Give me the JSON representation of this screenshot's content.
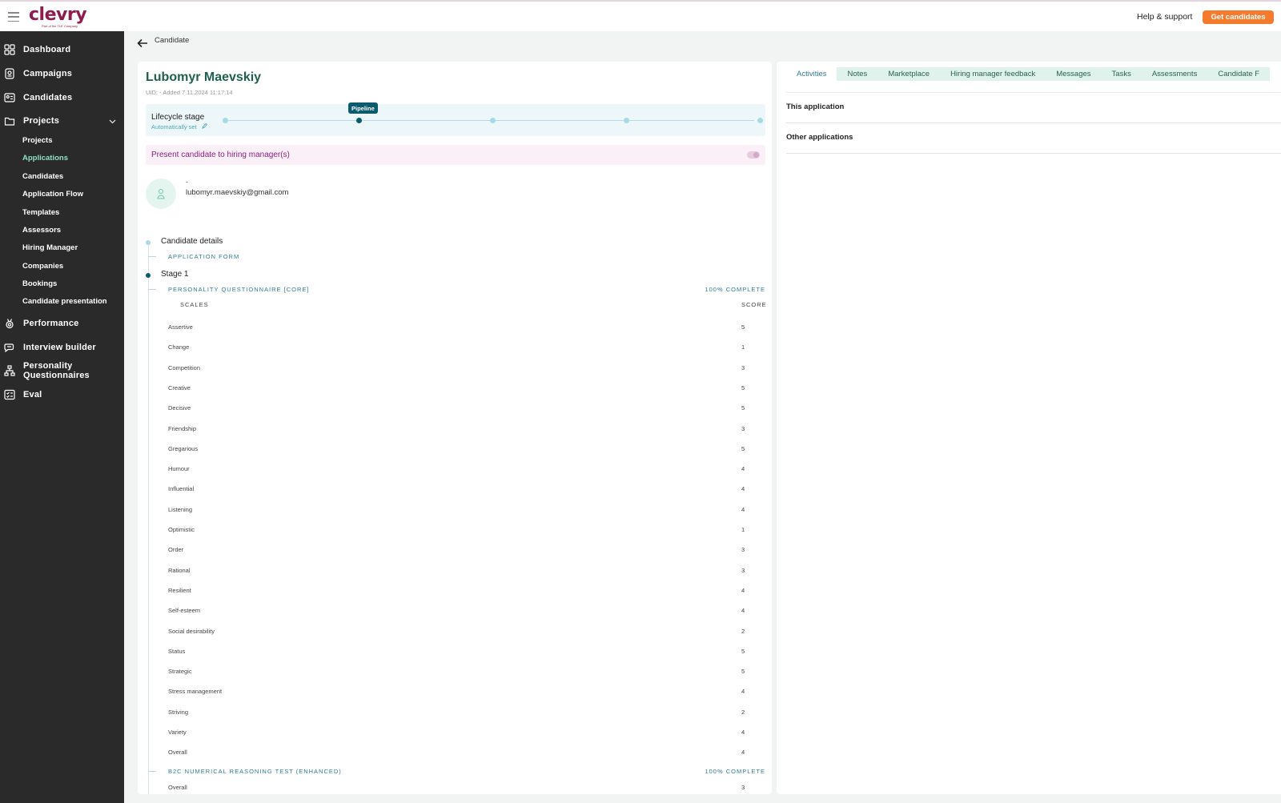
{
  "header": {
    "logo_text": "clevry",
    "logo_tagline": "Part of the TLE Company",
    "help_label": "Help & support",
    "cta_label": "Get candidates",
    "brand_color": "#8e1c4e",
    "cta_color": "#f47a2c"
  },
  "sidebar": {
    "items": [
      {
        "label": "Dashboard",
        "icon": "grid-icon"
      },
      {
        "label": "Campaigns",
        "icon": "campaign-icon"
      },
      {
        "label": "Candidates",
        "icon": "id-card-icon"
      },
      {
        "label": "Projects",
        "icon": "folder-icon"
      },
      {
        "label": "Performance",
        "icon": "medal-icon"
      },
      {
        "label": "Interview builder",
        "icon": "chat-icon"
      },
      {
        "label": "Personality Questionnaires",
        "icon": "hierarchy-icon"
      },
      {
        "label": "Eval",
        "icon": "checklist-icon"
      }
    ],
    "projects_sub": [
      "Projects",
      "Applications",
      "Candidates",
      "Application Flow",
      "Templates",
      "Assessors",
      "Hiring Manager",
      "Companies",
      "Bookings",
      "Candidate presentation"
    ],
    "active_sub": "Applications"
  },
  "breadcrumb": {
    "label": "Candidate"
  },
  "candidate": {
    "name": "Lubomyr Maevskiy",
    "meta": "UID: -   Added 7.11.2024 11:17:14",
    "contact_name": "-",
    "email": "lubomyr.maevskiy@gmail.com"
  },
  "lifecycle": {
    "title": "Lifecycle stage",
    "subtitle": "Automatically set",
    "active_label": "Pipeline",
    "stage_count": 5,
    "active_index": 1
  },
  "present": {
    "label": "Present candidate to hiring manager(s)",
    "enabled": false
  },
  "details": {
    "candidate_details": "Candidate details",
    "application_form": "APPLICATION FORM",
    "stage": "Stage 1",
    "pq_title": "PERSONALITY QUESTIONNAIRE [CORE]",
    "pq_status": "100% COMPLETE",
    "col_scales": "SCALES",
    "col_score": "SCORE",
    "scores": [
      {
        "scale": "Assertive",
        "score": "5"
      },
      {
        "scale": "Change",
        "score": "1"
      },
      {
        "scale": "Competition",
        "score": "3"
      },
      {
        "scale": "Creative",
        "score": "5"
      },
      {
        "scale": "Decisive",
        "score": "5"
      },
      {
        "scale": "Friendship",
        "score": "3"
      },
      {
        "scale": "Gregarious",
        "score": "5"
      },
      {
        "scale": "Humour",
        "score": "4"
      },
      {
        "scale": "Influential",
        "score": "4"
      },
      {
        "scale": "Listening",
        "score": "4"
      },
      {
        "scale": "Optimistic",
        "score": "1"
      },
      {
        "scale": "Order",
        "score": "3"
      },
      {
        "scale": "Rational",
        "score": "3"
      },
      {
        "scale": "Resilient",
        "score": "4"
      },
      {
        "scale": "Self-esteem",
        "score": "4"
      },
      {
        "scale": "Social desirability",
        "score": "2"
      },
      {
        "scale": "Status",
        "score": "5"
      },
      {
        "scale": "Strategic",
        "score": "5"
      },
      {
        "scale": "Stress management",
        "score": "4"
      },
      {
        "scale": "Striving",
        "score": "2"
      },
      {
        "scale": "Variety",
        "score": "4"
      },
      {
        "scale": "Overall",
        "score": "4"
      }
    ],
    "nr_title": "B2C NUMERICAL REASONING TEST (ENHANCED)",
    "nr_status": "100% COMPLETE",
    "nr_scores": [
      {
        "scale": "Overall",
        "score": "3"
      }
    ]
  },
  "right_panel": {
    "tabs": [
      "Activities",
      "Notes",
      "Marketplace",
      "Hiring manager feedback",
      "Messages",
      "Tasks",
      "Assessments",
      "Candidate F"
    ],
    "active_tab": "Activities",
    "sections": [
      "This application",
      "Other applications"
    ]
  }
}
